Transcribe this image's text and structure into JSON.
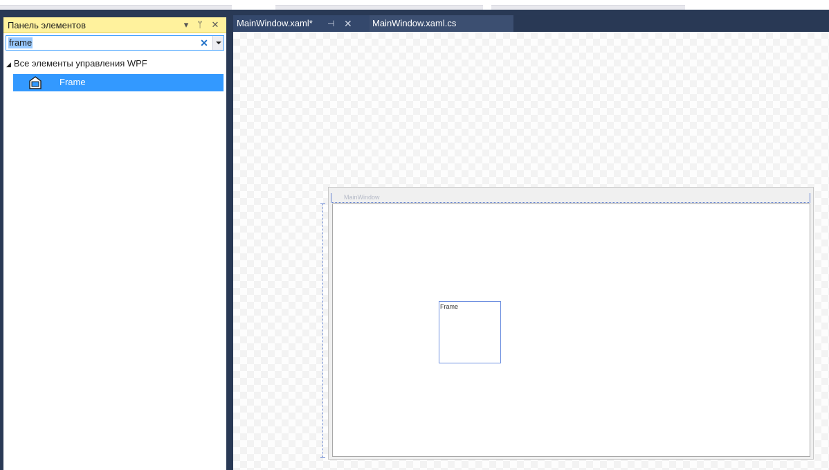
{
  "toolbox": {
    "title": "Панель элементов",
    "search_value": "frame",
    "group_label": "Все элементы управления WPF",
    "items": [
      {
        "label": "Frame",
        "icon": "frame-control-icon",
        "selected": true
      }
    ]
  },
  "tabs": [
    {
      "label": "MainWindow.xaml*",
      "active": true,
      "pinned": true
    },
    {
      "label": "MainWindow.xaml.cs",
      "active": false
    }
  ],
  "designer": {
    "window_title": "MainWindow",
    "frame_label": "Frame"
  },
  "colors": {
    "navy_background": "#293955",
    "toolbox_header": "#fff29d",
    "selection": "#3399ff",
    "tab_active": "#34486c"
  }
}
